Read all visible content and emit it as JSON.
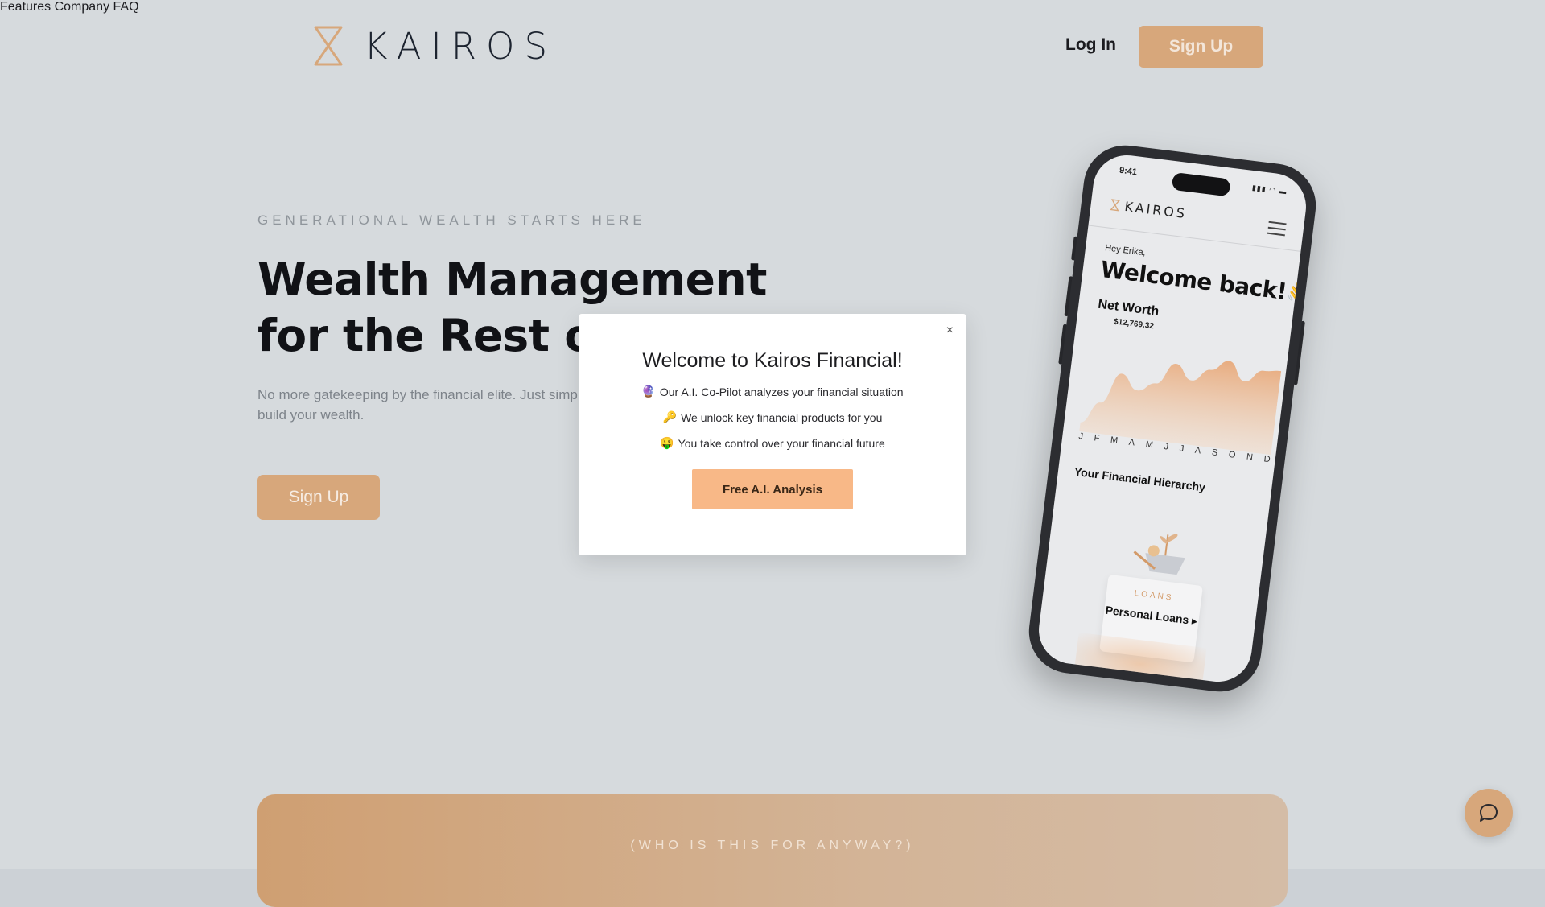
{
  "header": {
    "brand": "KAIROS",
    "nav": [
      "Features",
      "Company",
      "FAQ"
    ],
    "login_label": "Log In",
    "signup_label": "Sign Up"
  },
  "hero": {
    "eyebrow": "GENERATIONAL WEALTH STARTS HERE",
    "title_line1": "Wealth Management",
    "title_line2": "for the Rest of Us",
    "subtitle": "No more gatekeeping by the financial elite. Just simple, proven ways to build your wealth.",
    "signup_label": "Sign Up"
  },
  "phone": {
    "time": "9:41",
    "brand": "KAIROS",
    "greeting": "Hey Erika,",
    "welcome": "Welcome back!👋",
    "net_worth_label": "Net Worth",
    "net_worth_value": "$12,769.32",
    "months": [
      "J",
      "F",
      "M",
      "A",
      "M",
      "J",
      "J",
      "A",
      "S",
      "O",
      "N",
      "D"
    ],
    "hierarchy_title": "Your Financial Hierarchy",
    "loan_eyebrow": "LOANS",
    "loan_title": "Personal Loans ▸"
  },
  "chart_data": {
    "type": "area",
    "categories": [
      "J",
      "F",
      "M",
      "A",
      "M",
      "J",
      "J",
      "A",
      "S",
      "O",
      "N",
      "D"
    ],
    "values": [
      10,
      34,
      68,
      52,
      62,
      86,
      70,
      84,
      96,
      76,
      90,
      92
    ],
    "xlabel": "",
    "ylabel": "",
    "ylim": [
      0,
      100
    ],
    "color": "#e8a97a"
  },
  "modal": {
    "title": "Welcome to Kairos Financial!",
    "lines": [
      {
        "emoji": "🔮",
        "text": "Our A.I. Co-Pilot analyzes your financial situation"
      },
      {
        "emoji": "🔑",
        "text": "We unlock key financial products for you"
      },
      {
        "emoji": "🤑",
        "text": "You take control over your financial future"
      }
    ],
    "cta_label": "Free A.I. Analysis",
    "close_label": "×"
  },
  "band": {
    "text": "(WHO IS THIS FOR ANYWAY?)"
  }
}
